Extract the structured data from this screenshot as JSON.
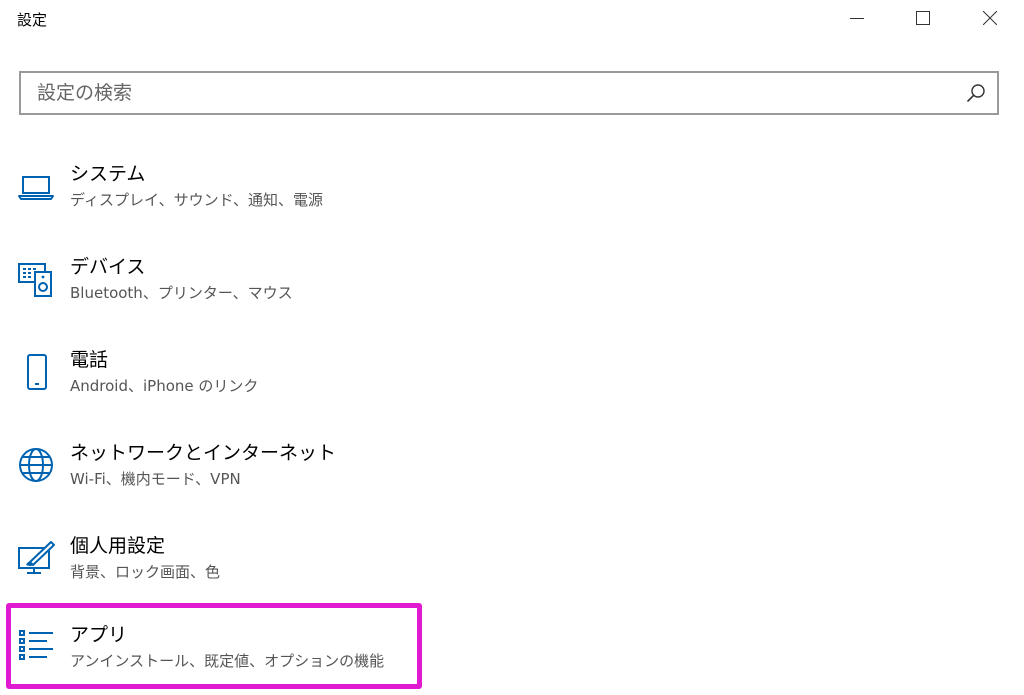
{
  "window": {
    "title": "設定"
  },
  "search": {
    "placeholder": "設定の検索",
    "value": ""
  },
  "settings": [
    {
      "label": "システム",
      "description": "ディスプレイ、サウンド、通知、電源",
      "icon": "laptop-icon"
    },
    {
      "label": "デバイス",
      "description": "Bluetooth、プリンター、マウス",
      "icon": "devices-icon"
    },
    {
      "label": "電話",
      "description": "Android、iPhone のリンク",
      "icon": "phone-icon"
    },
    {
      "label": "ネットワークとインターネット",
      "description": "Wi-Fi、機内モード、VPN",
      "icon": "globe-icon"
    },
    {
      "label": "個人用設定",
      "description": "背景、ロック画面、色",
      "icon": "personalization-icon"
    },
    {
      "label": "アプリ",
      "description": "アンインストール、既定値、オプションの機能",
      "icon": "apps-list-icon",
      "highlighted": true
    }
  ],
  "colors": {
    "accent": "#0063b1",
    "highlight": "#e01ad0",
    "search_border": "#999999"
  }
}
